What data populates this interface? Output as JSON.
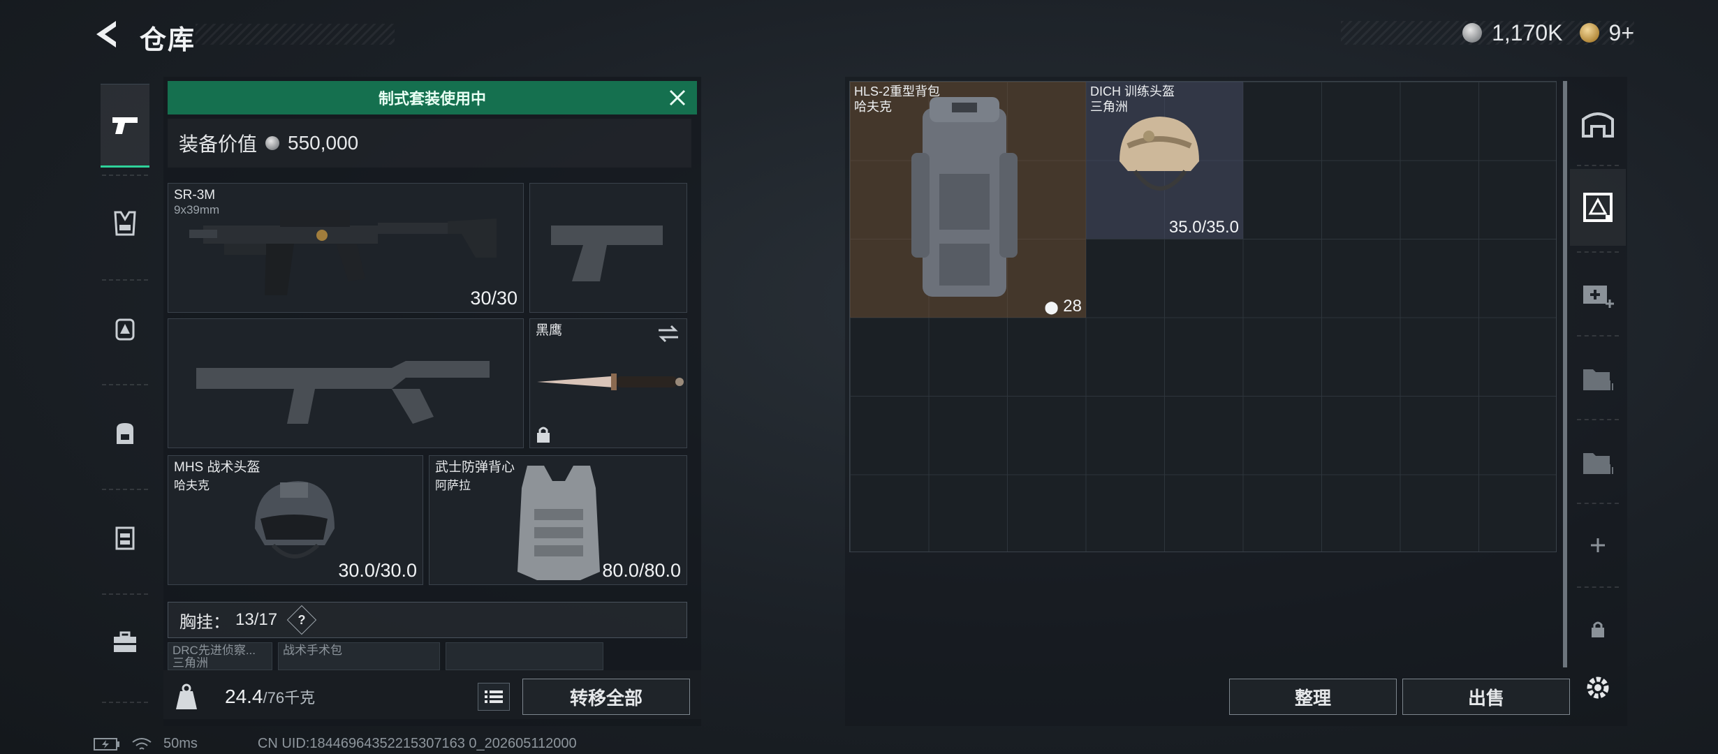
{
  "header": {
    "title": "仓库",
    "currency": {
      "silver": "1,170K",
      "gold": "9+"
    }
  },
  "loadout": {
    "kit_banner": "制式套装使用中",
    "value_label": "装备价值",
    "value": "550,000",
    "primary_weapon": {
      "name": "SR-3M",
      "ammo": "9x39mm",
      "count": "30/30"
    },
    "melee": {
      "name": "黑鹰"
    },
    "helmet": {
      "name": "MHS 战术头盔",
      "origin": "哈夫克",
      "durability": "30.0/30.0"
    },
    "armor": {
      "name": "武士防弹背心",
      "origin": "阿萨拉",
      "durability": "80.0/80.0"
    },
    "chest_rig": {
      "label": "胸挂：",
      "count": "13/17",
      "help": "?"
    },
    "pouches": [
      {
        "name": "DRC先进侦察...",
        "origin": "三角洲"
      },
      {
        "name": "战术手术包"
      }
    ],
    "weight": {
      "current": "24.4",
      "max": "/76千克"
    },
    "transfer_all_label": "转移全部"
  },
  "storage": {
    "items": [
      {
        "name": "HLS-2重型背包",
        "origin": "哈夫克",
        "count": "28"
      },
      {
        "name": "DICH 训练头盔",
        "origin": "三角洲",
        "durability": "35.0/35.0"
      }
    ],
    "sort_label": "整理",
    "sell_label": "出售"
  },
  "status": {
    "ping": "50ms",
    "uid": "CN UID:18446964352215307163 0_202605112000"
  },
  "colors": {
    "accent_green": "#15704f",
    "active_rail": "#2fd29a"
  }
}
